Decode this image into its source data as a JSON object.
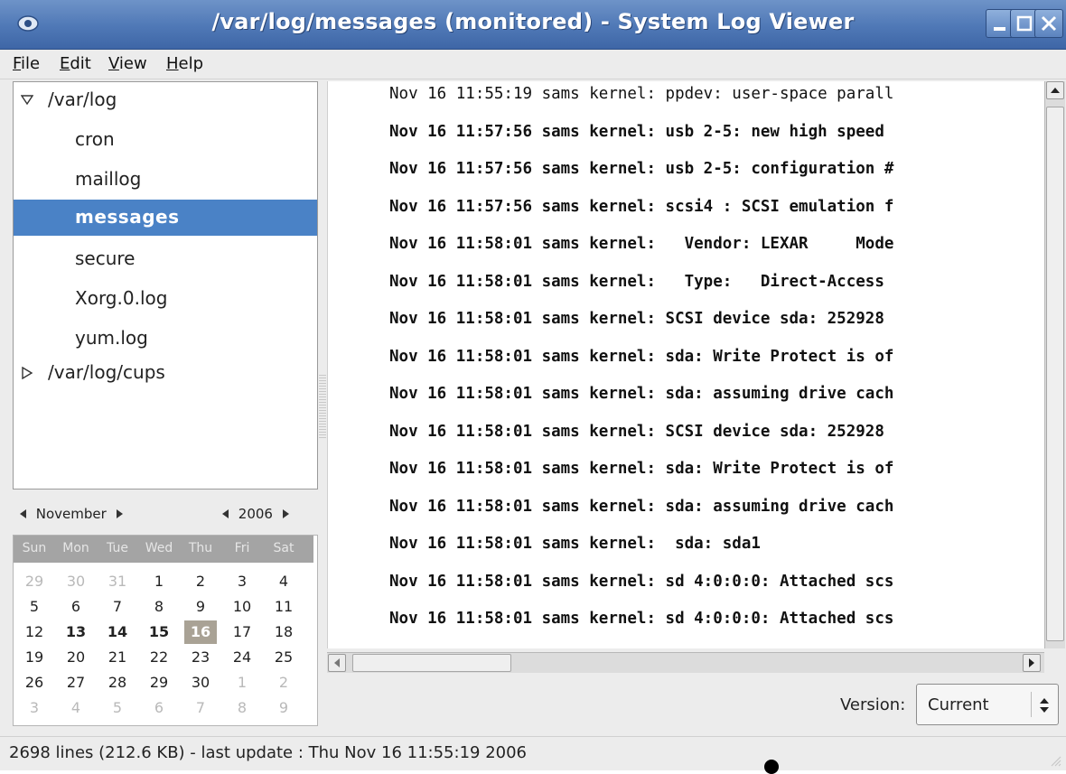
{
  "window": {
    "title": "/var/log/messages (monitored) - System Log Viewer",
    "accent": "#4f78b6"
  },
  "menu": {
    "file": "File",
    "edit": "Edit",
    "view": "View",
    "help": "Help"
  },
  "tree": {
    "root1": "/var/log",
    "items": [
      "cron",
      "maillog",
      "messages",
      "secure",
      "Xorg.0.log",
      "yum.log"
    ],
    "selected": "messages",
    "root2": "/var/log/cups",
    "selection_color": "#4a82c6"
  },
  "calendar": {
    "month": "November",
    "year": "2006",
    "dow": [
      "Sun",
      "Mon",
      "Tue",
      "Wed",
      "Thu",
      "Fri",
      "Sat"
    ],
    "weeks": [
      [
        "29",
        "30",
        "31",
        "1",
        "2",
        "3",
        "4"
      ],
      [
        "5",
        "6",
        "7",
        "8",
        "9",
        "10",
        "11"
      ],
      [
        "12",
        "13",
        "14",
        "15",
        "16",
        "17",
        "18"
      ],
      [
        "19",
        "20",
        "21",
        "22",
        "23",
        "24",
        "25"
      ],
      [
        "26",
        "27",
        "28",
        "29",
        "30",
        "1",
        "2"
      ],
      [
        "3",
        "4",
        "5",
        "6",
        "7",
        "8",
        "9"
      ]
    ],
    "bold_days": [
      "13",
      "14",
      "15"
    ],
    "today": "16"
  },
  "log": {
    "lines": [
      "Nov 16 11:55:19 sams kernel: ppdev: user-space parall",
      "Nov 16 11:57:56 sams kernel: usb 2-5: new high speed",
      "Nov 16 11:57:56 sams kernel: usb 2-5: configuration #",
      "Nov 16 11:57:56 sams kernel: scsi4 : SCSI emulation f",
      "Nov 16 11:58:01 sams kernel:   Vendor: LEXAR     Mode",
      "Nov 16 11:58:01 sams kernel:   Type:   Direct-Access",
      "Nov 16 11:58:01 sams kernel: SCSI device sda: 252928",
      "Nov 16 11:58:01 sams kernel: sda: Write Protect is of",
      "Nov 16 11:58:01 sams kernel: sda: assuming drive cach",
      "Nov 16 11:58:01 sams kernel: SCSI device sda: 252928",
      "Nov 16 11:58:01 sams kernel: sda: Write Protect is of",
      "Nov 16 11:58:01 sams kernel: sda: assuming drive cach",
      "Nov 16 11:58:01 sams kernel:  sda: sda1",
      "Nov 16 11:58:01 sams kernel: sd 4:0:0:0: Attached scs",
      "Nov 16 11:58:01 sams kernel: sd 4:0:0:0: Attached scs"
    ],
    "bold_from_index": 1
  },
  "version": {
    "label": "Version:",
    "value": "Current"
  },
  "status": {
    "text": "2698 lines (212.6 KB) - last update : Thu Nov 16 11:55:19 2006"
  }
}
